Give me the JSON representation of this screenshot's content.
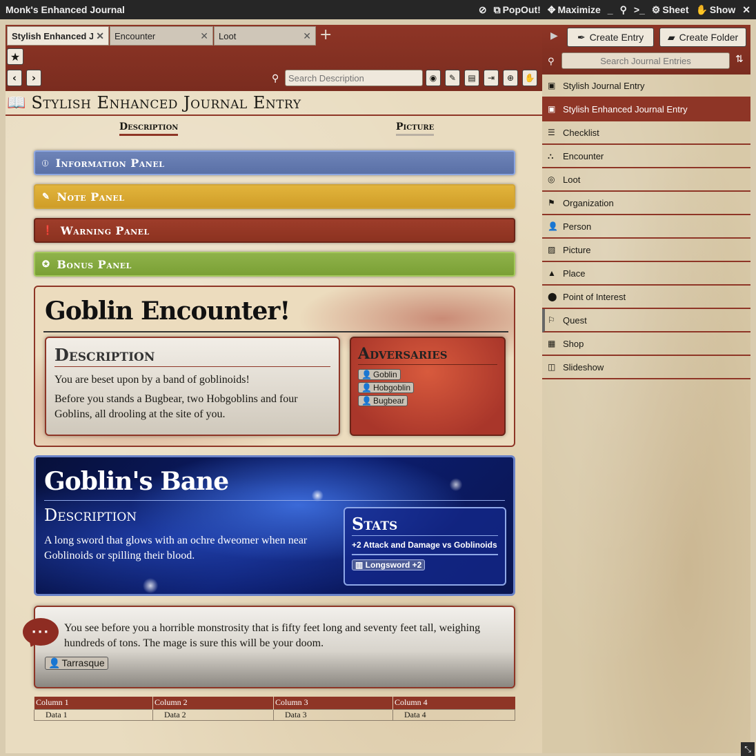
{
  "window": {
    "title": "Monk's Enhanced Journal",
    "controls": {
      "popout": "PopOut!",
      "maximize": "Maximize",
      "minimize": "_",
      "sheet": "Sheet",
      "show": "Show",
      "close": "✕"
    }
  },
  "tabs": [
    {
      "label": "Stylish Enhanced Jo…",
      "close": "✕"
    },
    {
      "label": "Encounter",
      "close": "✕"
    },
    {
      "label": "Loot",
      "close": "✕"
    }
  ],
  "tab_add": "+",
  "toolbar": {
    "back": "‹",
    "forward": "›",
    "search_placeholder": "Search Description"
  },
  "entry": {
    "title": "Stylish Enhanced Journal Entry",
    "subtabs": {
      "description": "Description",
      "picture": "Picture"
    }
  },
  "panels": {
    "info": "Information Panel",
    "note": "Note Panel",
    "warning": "Warning Panel",
    "bonus": "Bonus Panel"
  },
  "encounter": {
    "title": "Goblin Encounter!",
    "desc_heading": "Description",
    "desc_p1": "You are beset upon by a band of goblinoids!",
    "desc_p2": "Before you stands a Bugbear, two Hobgoblins and four Goblins, all drooling at the site of you.",
    "adv_heading": "Adversaries",
    "adversaries": [
      "Goblin",
      "Hobgoblin",
      "Bugbear"
    ]
  },
  "bane": {
    "title": "Goblin's Bane",
    "desc_heading": "Description",
    "desc": "A long sword that glows with an ochre dweomer when near Goblinoids or spilling their blood.",
    "stats_heading": "Stats",
    "stat_line": "+2 Attack and Damage vs Goblinoids",
    "item": "Longsword +2"
  },
  "monster": {
    "text": "You see before you a horrible monstrosity that is fifty feet long and seventy feet tall, weighing hundreds of tons. The mage is sure this will be your doom.",
    "actor": "Tarrasque"
  },
  "table": {
    "headers": [
      "Column 1",
      "Column 2",
      "Column 3",
      "Column 4"
    ],
    "row": [
      "Data 1",
      "Data 2",
      "Data 3",
      "Data 4"
    ]
  },
  "sidebar": {
    "create_entry": "Create Entry",
    "create_folder": "Create Folder",
    "search_placeholder": "Search Journal Entries",
    "items": [
      {
        "label": "Stylish Journal Entry",
        "icon": "book-icon"
      },
      {
        "label": "Stylish Enhanced Journal Entry",
        "icon": "book-icon"
      },
      {
        "label": "Checklist",
        "icon": "list-icon"
      },
      {
        "label": "Encounter",
        "icon": "encounter-icon"
      },
      {
        "label": "Loot",
        "icon": "coins-icon"
      },
      {
        "label": "Organization",
        "icon": "flag-icon"
      },
      {
        "label": "Person",
        "icon": "person-icon"
      },
      {
        "label": "Picture",
        "icon": "image-icon"
      },
      {
        "label": "Place",
        "icon": "place-icon"
      },
      {
        "label": "Point of Interest",
        "icon": "map-pin-icon"
      },
      {
        "label": "Quest",
        "icon": "signpost-icon"
      },
      {
        "label": "Shop",
        "icon": "shop-icon"
      },
      {
        "label": "Slideshow",
        "icon": "slideshow-icon"
      }
    ]
  },
  "colors": {
    "accent": "#8e3526",
    "info": "#6e84b8",
    "note": "#e2b43c",
    "warning": "#9e3d2a",
    "bonus": "#8fb24a"
  }
}
